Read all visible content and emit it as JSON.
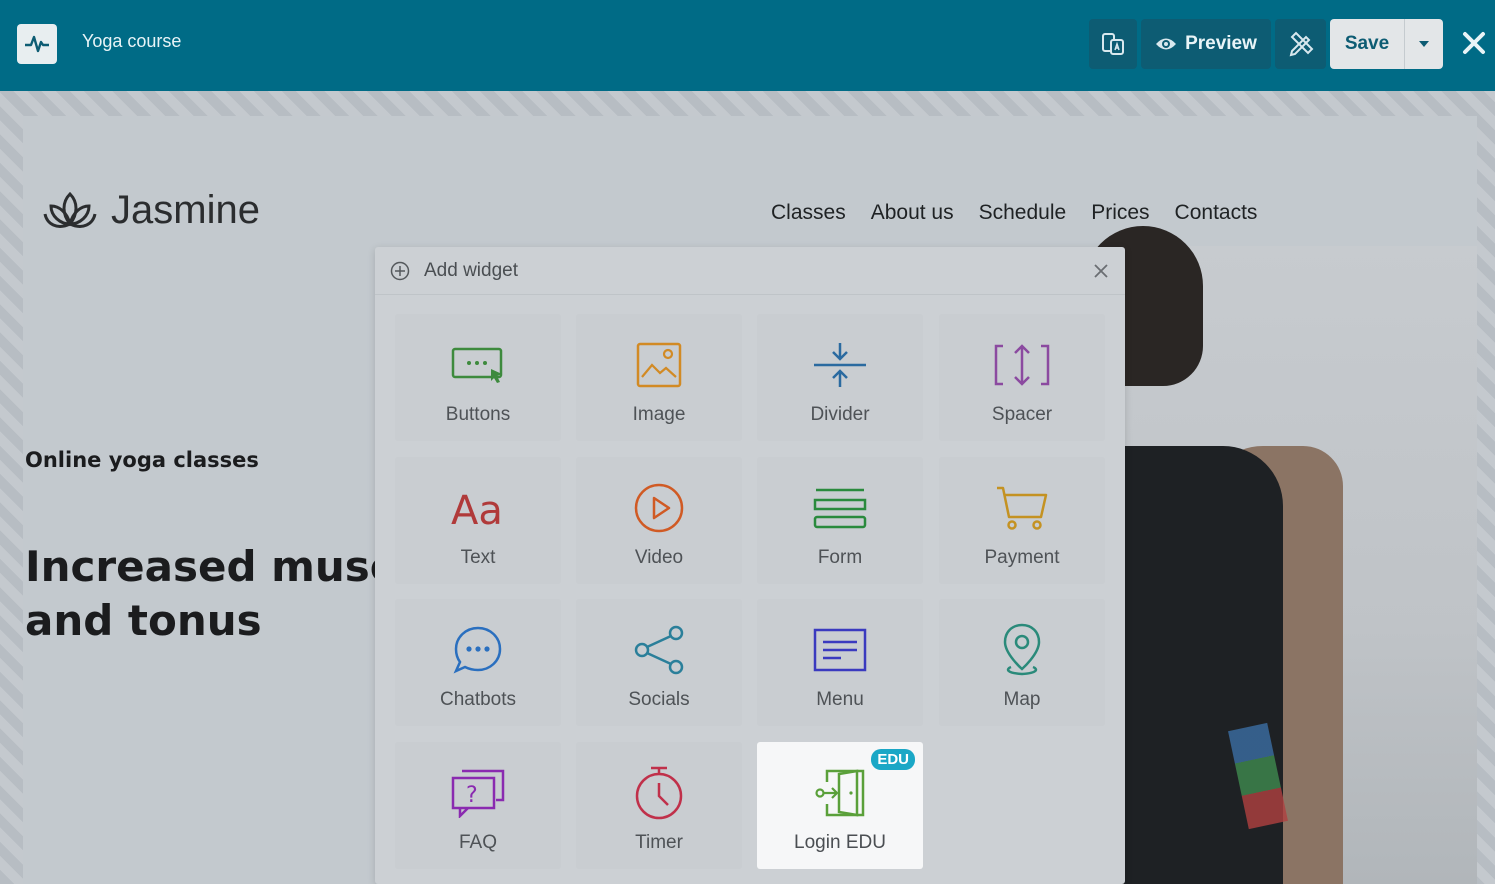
{
  "topbar": {
    "title": "Yoga course",
    "preview_label": "Preview",
    "save_label": "Save"
  },
  "site": {
    "brand": "Jasmine",
    "nav": [
      "Classes",
      "About us",
      "Schedule",
      "Prices",
      "Contacts"
    ],
    "subtitle": "Online yoga classes",
    "headline_line1": "Increased muscle",
    "headline_line2": "and tonus"
  },
  "modal": {
    "title": "Add widget",
    "widgets": [
      {
        "label": "Buttons",
        "icon": "buttons-icon",
        "color": "#3d8a3d"
      },
      {
        "label": "Image",
        "icon": "image-icon",
        "color": "#d28a24"
      },
      {
        "label": "Divider",
        "icon": "divider-icon",
        "color": "#2a6aa0"
      },
      {
        "label": "Spacer",
        "icon": "spacer-icon",
        "color": "#8b4aa0"
      },
      {
        "label": "Text",
        "icon": "text-icon",
        "color": "#b03a3a"
      },
      {
        "label": "Video",
        "icon": "video-icon",
        "color": "#d05a24"
      },
      {
        "label": "Form",
        "icon": "form-icon",
        "color": "#2a8a3d"
      },
      {
        "label": "Payment",
        "icon": "cart-icon",
        "color": "#c49222"
      },
      {
        "label": "Chatbots",
        "icon": "chatbot-icon",
        "color": "#2a6fbf"
      },
      {
        "label": "Socials",
        "icon": "share-icon",
        "color": "#2a7f9a"
      },
      {
        "label": "Menu",
        "icon": "menu-icon",
        "color": "#3a3abf"
      },
      {
        "label": "Map",
        "icon": "map-pin-icon",
        "color": "#2a8a7a"
      },
      {
        "label": "FAQ",
        "icon": "faq-icon",
        "color": "#8a2ab0"
      },
      {
        "label": "Timer",
        "icon": "timer-icon",
        "color": "#c0304a"
      },
      {
        "label": "Login EDU",
        "icon": "login-icon",
        "color": "#5aa03a",
        "badge": "EDU"
      }
    ]
  }
}
